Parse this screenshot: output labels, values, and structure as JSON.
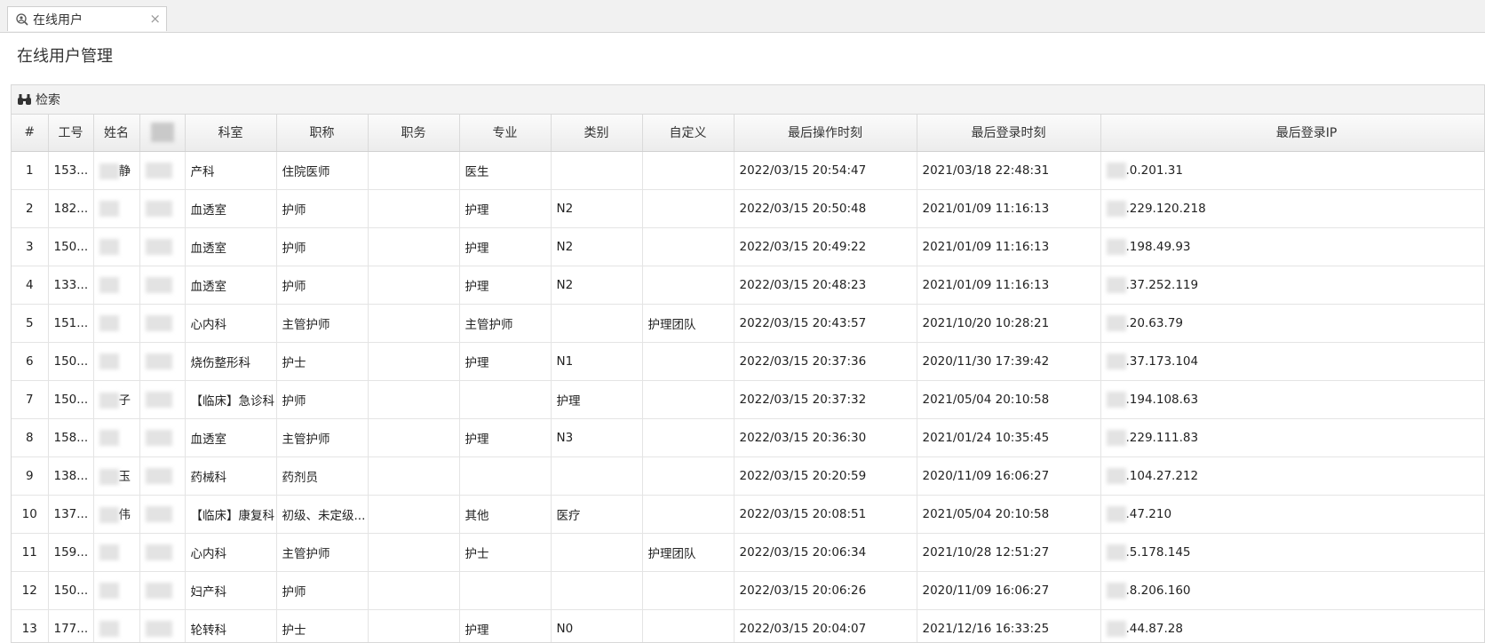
{
  "tab": {
    "label": "在线用户",
    "close": "×"
  },
  "page_title": "在线用户管理",
  "search_label": "检索",
  "columns": [
    "#",
    "工号",
    "姓名",
    "",
    "科室",
    "职称",
    "职务",
    "专业",
    "类别",
    "自定义",
    "最后操作时刻",
    "最后登录时刻",
    "最后登录IP"
  ],
  "rows": [
    {
      "no": "1",
      "id": "153...",
      "name": "静",
      "dept": "产科",
      "title": "住院医师",
      "duty": "",
      "major": "医生",
      "category": "",
      "custom": "",
      "last_op": "2022/03/15 20:54:47",
      "last_login": "2021/03/18 22:48:31",
      "ip": ".0.201.31"
    },
    {
      "no": "2",
      "id": "182...",
      "name": "",
      "dept": "血透室",
      "title": "护师",
      "duty": "",
      "major": "护理",
      "category": "N2",
      "custom": "",
      "last_op": "2022/03/15 20:50:48",
      "last_login": "2021/01/09 11:16:13",
      "ip": ".229.120.218"
    },
    {
      "no": "3",
      "id": "150...",
      "name": "",
      "dept": "血透室",
      "title": "护师",
      "duty": "",
      "major": "护理",
      "category": "N2",
      "custom": "",
      "last_op": "2022/03/15 20:49:22",
      "last_login": "2021/01/09 11:16:13",
      "ip": ".198.49.93"
    },
    {
      "no": "4",
      "id": "133...",
      "name": "",
      "dept": "血透室",
      "title": "护师",
      "duty": "",
      "major": "护理",
      "category": "N2",
      "custom": "",
      "last_op": "2022/03/15 20:48:23",
      "last_login": "2021/01/09 11:16:13",
      "ip": ".37.252.119"
    },
    {
      "no": "5",
      "id": "151...",
      "name": "",
      "dept": "心内科",
      "title": "主管护师",
      "duty": "",
      "major": "主管护师",
      "category": "",
      "custom": "护理团队",
      "last_op": "2022/03/15 20:43:57",
      "last_login": "2021/10/20 10:28:21",
      "ip": ".20.63.79"
    },
    {
      "no": "6",
      "id": "150...",
      "name": "",
      "dept": "烧伤整形科",
      "title": "护士",
      "duty": "",
      "major": "护理",
      "category": "N1",
      "custom": "",
      "last_op": "2022/03/15 20:37:36",
      "last_login": "2020/11/30 17:39:42",
      "ip": ".37.173.104"
    },
    {
      "no": "7",
      "id": "150...",
      "name": "子",
      "dept": "【临床】急诊科",
      "title": "护师",
      "duty": "",
      "major": "",
      "category": "护理",
      "custom": "",
      "last_op": "2022/03/15 20:37:32",
      "last_login": "2021/05/04 20:10:58",
      "ip": ".194.108.63"
    },
    {
      "no": "8",
      "id": "158...",
      "name": "",
      "dept": "血透室",
      "title": "主管护师",
      "duty": "",
      "major": "护理",
      "category": "N3",
      "custom": "",
      "last_op": "2022/03/15 20:36:30",
      "last_login": "2021/01/24 10:35:45",
      "ip": ".229.111.83"
    },
    {
      "no": "9",
      "id": "138...",
      "name": "玉",
      "dept": "药械科",
      "title": "药剂员",
      "duty": "",
      "major": "",
      "category": "",
      "custom": "",
      "last_op": "2022/03/15 20:20:59",
      "last_login": "2020/11/09 16:06:27",
      "ip": ".104.27.212"
    },
    {
      "no": "10",
      "id": "137...",
      "name": "伟",
      "dept": "【临床】康复科",
      "title": "初级、未定级...",
      "duty": "",
      "major": "其他",
      "category": "医疗",
      "custom": "",
      "last_op": "2022/03/15 20:08:51",
      "last_login": "2021/05/04 20:10:58",
      "ip": ".47.210"
    },
    {
      "no": "11",
      "id": "159...",
      "name": "",
      "dept": "心内科",
      "title": "主管护师",
      "duty": "",
      "major": "护士",
      "category": "",
      "custom": "护理团队",
      "last_op": "2022/03/15 20:06:34",
      "last_login": "2021/10/28 12:51:27",
      "ip": ".5.178.145"
    },
    {
      "no": "12",
      "id": "150...",
      "name": "",
      "dept": "妇产科",
      "title": "护师",
      "duty": "",
      "major": "",
      "category": "",
      "custom": "",
      "last_op": "2022/03/15 20:06:26",
      "last_login": "2020/11/09 16:06:27",
      "ip": ".8.206.160"
    },
    {
      "no": "13",
      "id": "177...",
      "name": "",
      "dept": "轮转科",
      "title": "护士",
      "duty": "",
      "major": "护理",
      "category": "N0",
      "custom": "",
      "last_op": "2022/03/15 20:04:07",
      "last_login": "2021/12/16 16:33:25",
      "ip": ".44.87.28"
    }
  ]
}
